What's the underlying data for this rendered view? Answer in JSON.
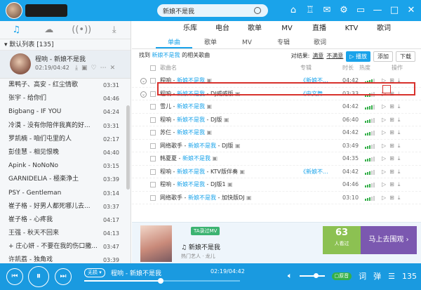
{
  "search": {
    "value": "新娘不是我"
  },
  "left": {
    "tabs": [
      "♫",
      "☁",
      "((•))",
      "⤓"
    ],
    "playlist_title": "默认列表",
    "playlist_count": "[135]",
    "current": {
      "title": "程响 - 新娘不是我",
      "time": "02:19/04:42"
    },
    "items": [
      {
        "name": "黑鸭子、高安 - 红尘情歌",
        "dur": "03:31"
      },
      {
        "name": "张宇 - 给你们",
        "dur": "04:46"
      },
      {
        "name": "Bigbang - IF YOU",
        "dur": "04:24"
      },
      {
        "name": "冷漠 - 没有你陪伴我真的好...",
        "dur": "03:31"
      },
      {
        "name": "罗凯楠 - 咱们屯里的人",
        "dur": "02:17"
      },
      {
        "name": "彭佳慧 - 相见恨晚",
        "dur": "04:40"
      },
      {
        "name": "Apink - NoNoNo",
        "dur": "03:15"
      },
      {
        "name": "GARNIDELIA - 極楽浄土",
        "dur": "03:39"
      },
      {
        "name": "PSY - Gentleman",
        "dur": "03:14"
      },
      {
        "name": "崔子格 - 好男人都死哪儿去...",
        "dur": "03:37"
      },
      {
        "name": "崔子格 - 心疼我",
        "dur": "04:17"
      },
      {
        "name": "王强 - 秋天不回来",
        "dur": "04:13"
      },
      {
        "name": "+ 庄心妍 - 不要在我的伤口撒...",
        "dur": "03:47"
      },
      {
        "name": "许凯荔 - 独角戏",
        "dur": "03:39"
      }
    ]
  },
  "nav": [
    "乐库",
    "电台",
    "歌单",
    "MV",
    "直播",
    "KTV",
    "歌词"
  ],
  "subtabs": [
    "单曲",
    "歌单",
    "MV",
    "专辑",
    "歌词"
  ],
  "result": {
    "prefix": "找到",
    "keyword": "新娘不是我",
    "suffix": "的相关歌曲",
    "compare_label": "对结果:",
    "opt1": "满意",
    "opt2": "不满意",
    "play_label": "▷ 播放",
    "add_label": "添加",
    "download_label": "下载"
  },
  "table": {
    "headers": {
      "name": "歌曲名",
      "album": "专辑",
      "duration": "时长",
      "hot": "热度",
      "ops": "操作"
    },
    "rows": [
      {
        "artist": "程响 - ",
        "song": "新娘不是我",
        "extra": "",
        "album": "《新娘不...",
        "dur": "04:42",
        "hot": 4
      },
      {
        "artist": "程响 - ",
        "song": "新娘不是我",
        "extra": " - DJ威威版",
        "album": "《中文舞...",
        "dur": "03:33",
        "hot": 3
      },
      {
        "artist": "雪儿 - ",
        "song": "新娘不是我",
        "extra": "",
        "album": "",
        "dur": "04:42",
        "hot": 4
      },
      {
        "artist": "程响 - ",
        "song": "新娘不是我",
        "extra": " - DJ版",
        "album": "",
        "dur": "06:40",
        "hot": 3
      },
      {
        "artist": "苏仨 - ",
        "song": "新娘不是我",
        "extra": "",
        "album": "",
        "dur": "04:42",
        "hot": 3
      },
      {
        "artist": "网络歌手 - ",
        "song": "新娘不是我",
        "extra": " - DJ版",
        "album": "",
        "dur": "03:49",
        "hot": 3
      },
      {
        "artist": "韩夏夏 - ",
        "song": "新娘不是我",
        "extra": "",
        "album": "",
        "dur": "04:35",
        "hot": 3
      },
      {
        "artist": "程响 - ",
        "song": "新娘不是我",
        "extra": " - KTV版伴奏",
        "album": "《新娘不...",
        "dur": "04:42",
        "hot": 3
      },
      {
        "artist": "程响 - ",
        "song": "新娘不是我",
        "extra": " - DJ版1",
        "album": "",
        "dur": "04:46",
        "hot": 3
      },
      {
        "artist": "网络歌手 - ",
        "song": "新娘不是我",
        "extra": " - 加快版DJ",
        "album": "",
        "dur": "03:10",
        "hot": 3
      }
    ]
  },
  "promo": {
    "tag": "TA录过MV",
    "song": "♫ 新娘不是我",
    "sub": "热门艺人 · 龙儿",
    "count": "63",
    "count_label": "人看过",
    "go": "马上去围观 ›"
  },
  "player": {
    "quality": "无损 ▾",
    "title": "程响 - 新娘不是我",
    "time": "02:19/04:42",
    "progress": 0.49,
    "lyric_btn": "词",
    "danmu_btn": "弹",
    "pill": "▢原音",
    "count": "135"
  }
}
